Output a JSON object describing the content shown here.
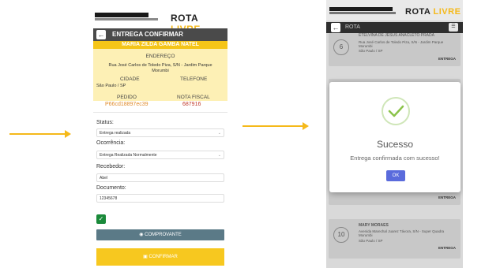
{
  "app": {
    "logo_r": "R",
    "logo_ota": "OTA",
    "logo_livre": "LIVRE"
  },
  "screen1": {
    "title": "ENTREGA CONFIRMAR",
    "client_name": "MARIA ZILDA GAMBA NATEL",
    "address_label": "ENDEREÇO",
    "address": "Rua José Carlos de Toledo Piza, S/N - Jardim Parque Morumbi",
    "city_label": "CIDADE",
    "phone_label": "TELEFONE",
    "city": "São Paulo / SP",
    "order_label": "PEDIDO",
    "order": "P66cd18897ec39",
    "invoice_label": "NOTA FISCAL",
    "invoice": "687916",
    "status_label": "Status:",
    "status_value": "Entrega realizada",
    "occurrence_label": "Ocorrência:",
    "occurrence_value": "Entrega Realizada Normalmente",
    "receiver_label": "Recebedor:",
    "receiver_value": "Abel",
    "document_label": "Documento:",
    "document_value": "12345678",
    "proof_button": "COMPROVANTE",
    "confirm_button": "CONFIRMAR"
  },
  "screen2": {
    "title": "ROTA",
    "card1": {
      "number": "6",
      "name": "ETELVINA DE JESUS ANACLETO PRADA",
      "address": "Rua José Carlos de Toledo Piza, S/N - Jardim Parque Morumbi",
      "city": "São Paulo / SP",
      "tag": "ENTREGA"
    },
    "card_hidden_tag": "ENTREGA",
    "card3": {
      "number": "10",
      "name": "MARY MORAES",
      "address": "Avenida Marechal Juarez Távora, S/N - Super Quadra Morumbi",
      "city": "São Paulo / SP",
      "tag": "ENTREGA"
    },
    "modal_title": "Sucesso",
    "modal_message": "Entrega confirmada com sucesso!",
    "modal_ok": "OK"
  },
  "colors": {
    "accent": "#f5b91a",
    "success": "#8bc34a",
    "primary_button": "#5a6bdc"
  }
}
